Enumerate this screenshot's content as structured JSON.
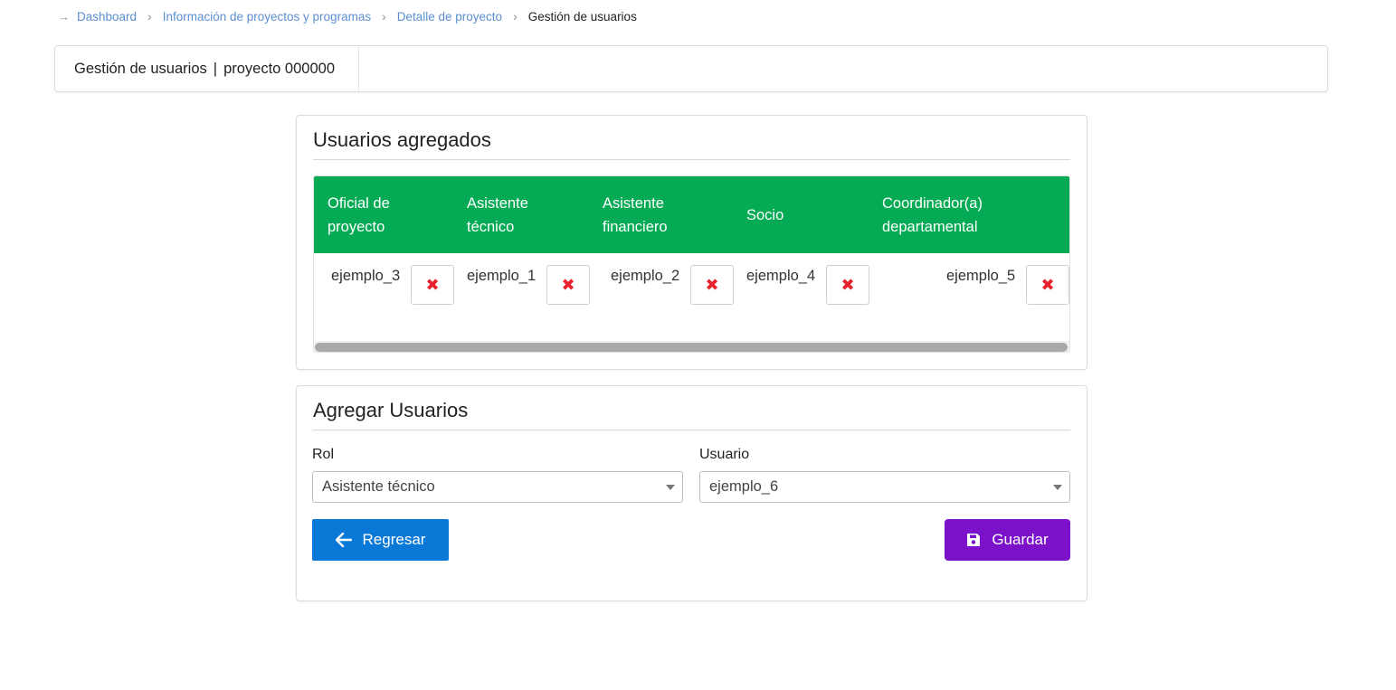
{
  "breadcrumb": {
    "items": [
      "Dashboard",
      "Información de proyectos y programas",
      "Detalle de proyecto"
    ],
    "current": "Gestión de usuarios"
  },
  "title_bar": {
    "section": "Gestión de usuarios",
    "separator": "|",
    "project": "proyecto 000000"
  },
  "users_card": {
    "heading": "Usuarios agregados",
    "columns": [
      {
        "header_line1": "Oficial de",
        "header_line2": "proyecto",
        "user": "ejemplo_3"
      },
      {
        "header_line1": "Asistente",
        "header_line2": "técnico",
        "user": "ejemplo_1"
      },
      {
        "header_line1": "Asistente",
        "header_line2": "financiero",
        "user": "ejemplo_2"
      },
      {
        "header_line1": "Socio",
        "header_line2": "",
        "user": "ejemplo_4"
      },
      {
        "header_line1": "Coordinador(a)",
        "header_line2": "departamental",
        "user": "ejemplo_5"
      }
    ],
    "delete_icon": "✖"
  },
  "add_card": {
    "heading": "Agregar Usuarios",
    "role_label": "Rol",
    "role_value": "Asistente técnico",
    "user_label": "Usuario",
    "user_value": "ejemplo_6",
    "back_label": "Regresar",
    "save_label": "Guardar"
  },
  "icons": {
    "breadcrumb_arrow": "arrow-right-icon",
    "breadcrumb_separator": "chevron-right-icon",
    "delete": "close-icon",
    "back": "arrow-left-icon",
    "save": "save-icon"
  },
  "colors": {
    "table_header": "#05aa55",
    "back_button": "#0a78d7",
    "save_button": "#7b11c8",
    "delete_icon": "#e8232d",
    "link": "#5b8fd0"
  }
}
